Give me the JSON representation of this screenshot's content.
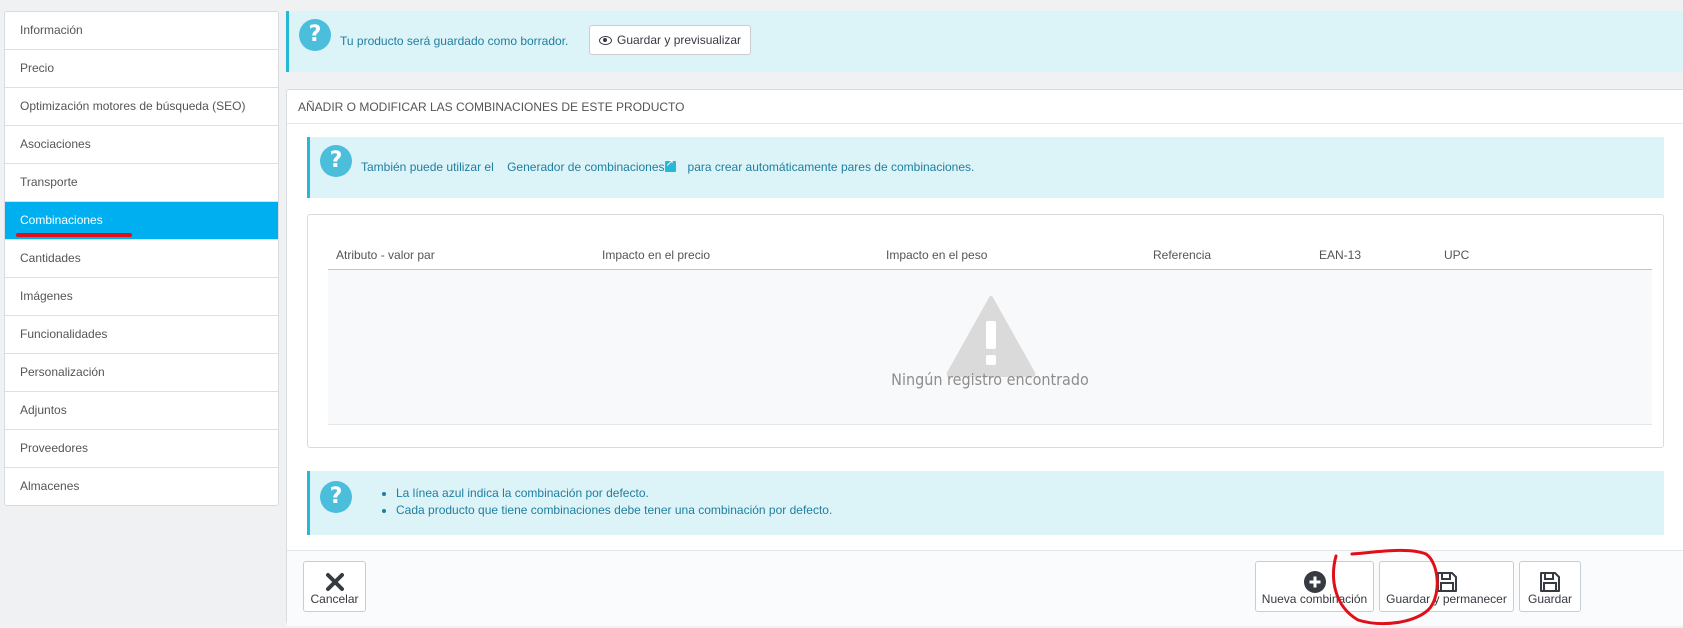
{
  "sidebar": {
    "items": [
      {
        "label": "Información"
      },
      {
        "label": "Precio"
      },
      {
        "label": "Optimización motores de búsqueda (SEO)"
      },
      {
        "label": "Asociaciones"
      },
      {
        "label": "Transporte"
      },
      {
        "label": "Combinaciones",
        "active": true
      },
      {
        "label": "Cantidades"
      },
      {
        "label": "Imágenes"
      },
      {
        "label": "Funcionalidades"
      },
      {
        "label": "Personalización"
      },
      {
        "label": "Adjuntos"
      },
      {
        "label": "Proveedores"
      },
      {
        "label": "Almacenes"
      }
    ]
  },
  "top_alert": {
    "message": "Tu producto será guardado como borrador.",
    "preview_button": "Guardar y previsualizar"
  },
  "panel": {
    "heading": "AÑADIR O MODIFICAR LAS COMBINACIONES DE ESTE PRODUCTO",
    "generator_alert": {
      "before": "También puede utilizar el",
      "link": "Generador de combinaciones",
      "after": "para crear automáticamente pares de combinaciones."
    },
    "table": {
      "columns": [
        "Atributo - valor par",
        "Impacto en el precio",
        "Impacto en el peso",
        "Referencia",
        "EAN-13",
        "UPC"
      ],
      "empty_message": "Ningún registro encontrado"
    },
    "default_alert": {
      "items": [
        "La línea azul indica la combinación por defecto.",
        "Cada producto que tiene combinaciones debe tener una combinación por defecto."
      ]
    },
    "footer": {
      "cancel": "Cancelar",
      "new_combination": "Nueva combinación",
      "save_stay": "Guardar y permanecer",
      "save": "Guardar"
    }
  },
  "colors": {
    "accent": "#00aff0",
    "info_bg": "#dcf3f8",
    "info_text": "#1f7fa0",
    "annotation": "#e0101a"
  },
  "icons": [
    "question-icon",
    "eye-icon",
    "external-link-icon",
    "warning-icon",
    "close-icon",
    "plus-circle-icon",
    "floppy-disk-icon"
  ]
}
